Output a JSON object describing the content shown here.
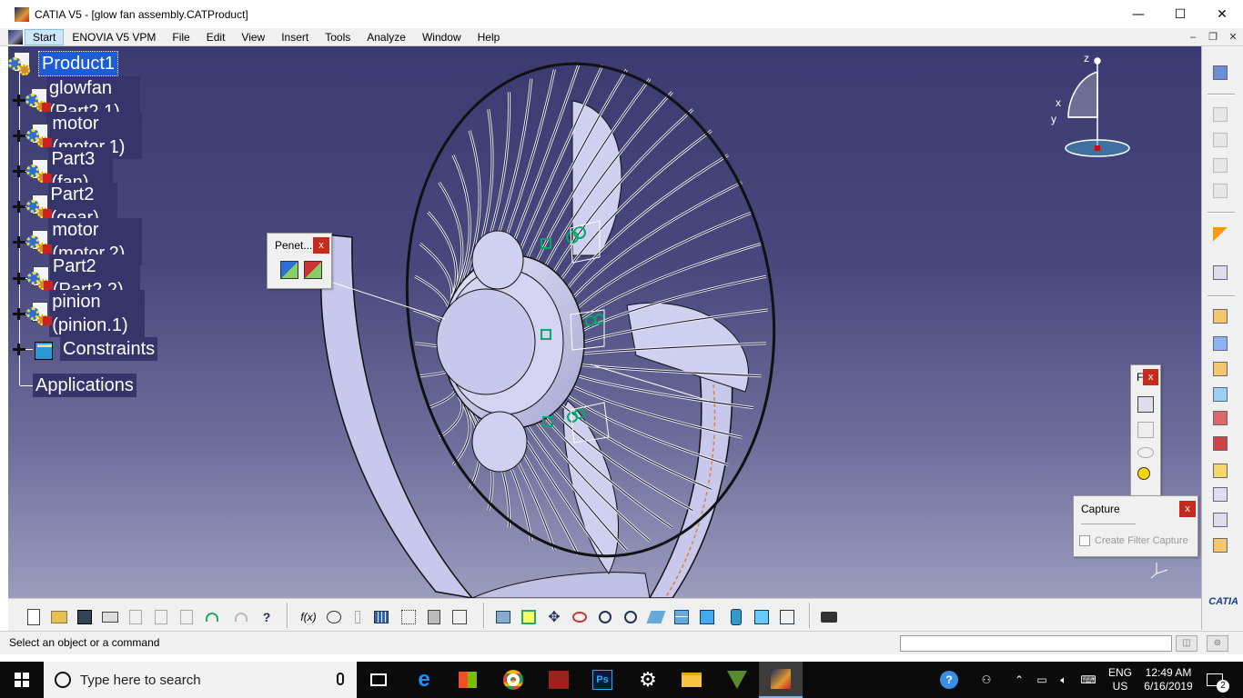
{
  "window": {
    "title": "CATIA V5 - [glow fan assembly.CATProduct]",
    "controls": {
      "minimize": "—",
      "maximize": "☐",
      "close": "✕"
    }
  },
  "menubar": {
    "items": [
      "Start",
      "ENOVIA V5 VPM",
      "File",
      "Edit",
      "View",
      "Insert",
      "Tools",
      "Analyze",
      "Window",
      "Help"
    ]
  },
  "tree": {
    "root": "Product1",
    "children": [
      {
        "label": "glowfan (Part2.1)",
        "icon": "part-icon"
      },
      {
        "label": "motor (motor.1)",
        "icon": "part-icon"
      },
      {
        "label": "Part3 (fan)",
        "icon": "part-icon"
      },
      {
        "label": "Part2 (gear)",
        "icon": "part-icon"
      },
      {
        "label": "motor (motor.2)",
        "icon": "part-icon"
      },
      {
        "label": "Part2 (Part2.2)",
        "icon": "part-icon"
      },
      {
        "label": "pinion (pinion.1)",
        "icon": "part-icon"
      },
      {
        "label": "Constraints",
        "icon": "constraints-icon"
      },
      {
        "label": "Applications",
        "icon": "none"
      }
    ]
  },
  "compass": {
    "z": "z",
    "x": "x",
    "y": "y"
  },
  "toolbars": {
    "penetration": {
      "title": "Penet...",
      "close": "x"
    },
    "filter": {
      "title": "F",
      "close": "x"
    },
    "capture": {
      "title": "Capture",
      "close": "x",
      "option": "Create Filter Capture"
    }
  },
  "status": {
    "message": "Select an object or a command",
    "command_input": ""
  },
  "brand": {
    "logo_text": "CATIA"
  },
  "taskbar": {
    "search_placeholder": "Type here to search",
    "language": "ENG",
    "region": "US",
    "time": "12:49 AM",
    "date": "6/16/2019",
    "notification_count": "2"
  },
  "colors": {
    "viewport_top": "#3b3b72",
    "viewport_bottom": "#9c9cbe",
    "selection": "#1e5cd6",
    "fan_fill": "#c8c8ec"
  }
}
